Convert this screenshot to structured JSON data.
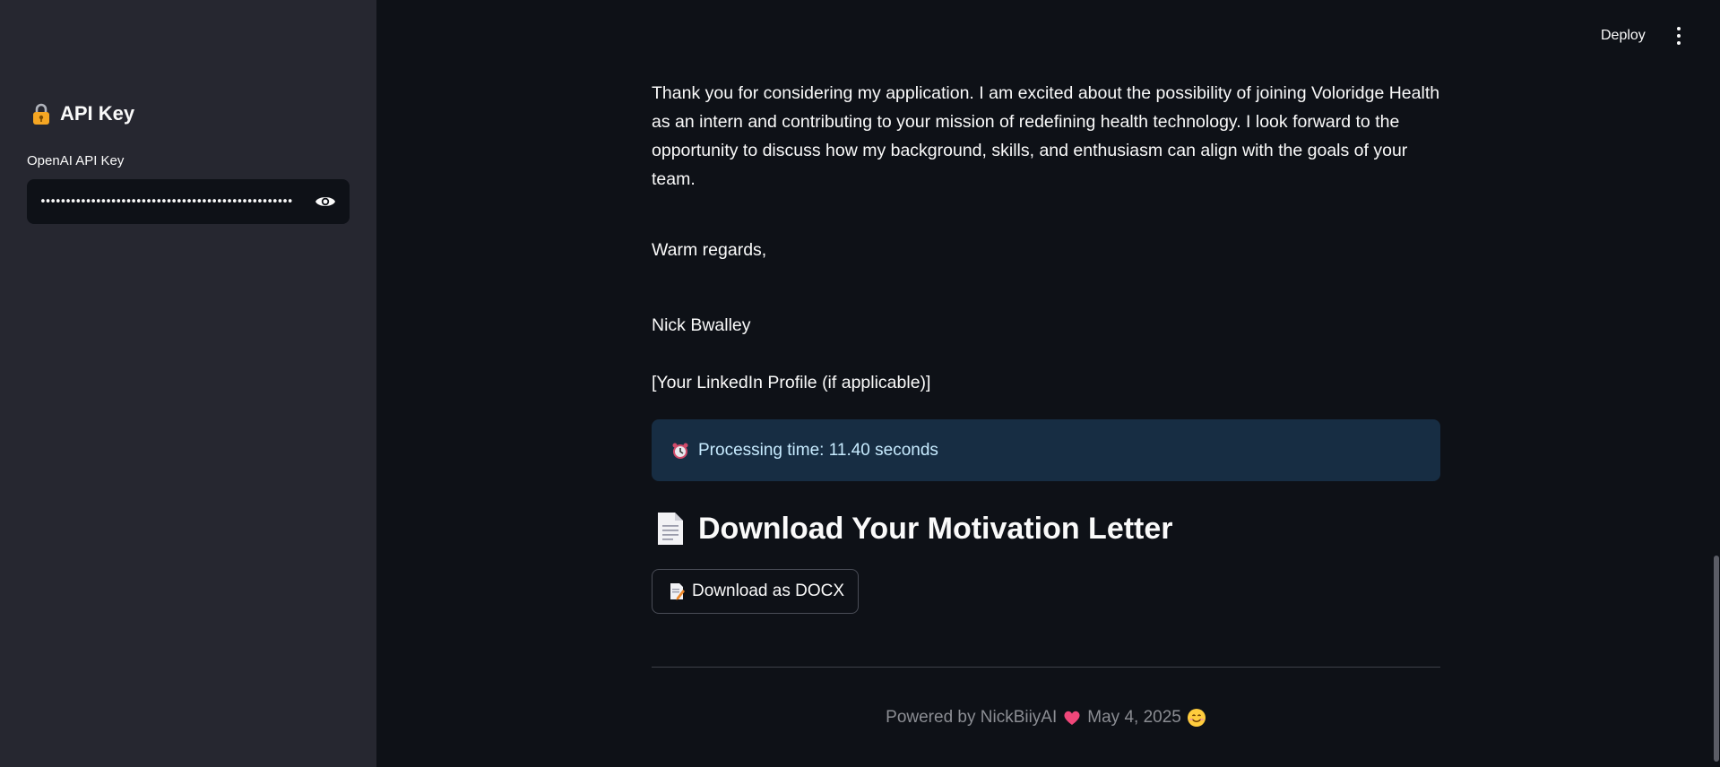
{
  "sidebar": {
    "title": "API Key",
    "title_icon": "lock-icon",
    "api_key_label": "OpenAI API Key",
    "api_key_value": "••••••••••••••••••••••••••••••••••••••••••••••••••",
    "reveal_icon": "eye-icon"
  },
  "header": {
    "deploy_label": "Deploy",
    "menu_icon": "kebab-menu-icon"
  },
  "letter": {
    "paragraph": "Thank you for considering my application. I am excited about the possibility of joining Voloridge Health as an intern and contributing to your mission of redefining health technology. I look forward to the opportunity to discuss how my background, skills, and enthusiasm can align with the goals of your team.",
    "closing": "Warm regards,",
    "signature": "Nick Bwalley",
    "linkedin": "[Your LinkedIn Profile (if applicable)]"
  },
  "info": {
    "icon": "alarm-clock-icon",
    "text": "Processing time: 11.40 seconds"
  },
  "download_section": {
    "heading": "Download Your Motivation Letter",
    "heading_icon": "document-icon",
    "button_label": "Download as DOCX",
    "button_icon": "memo-icon"
  },
  "footer": {
    "powered_by": "Powered by NickBiiyAI",
    "date": "May 4, 2025",
    "heart_icon": "heart-icon",
    "smile_icon": "smile-icon"
  },
  "colors": {
    "background": "#0e1117",
    "sidebar": "#262730",
    "info_bg": "#172d43",
    "info_text": "#c7ebff",
    "muted_text": "#8b8d93"
  }
}
